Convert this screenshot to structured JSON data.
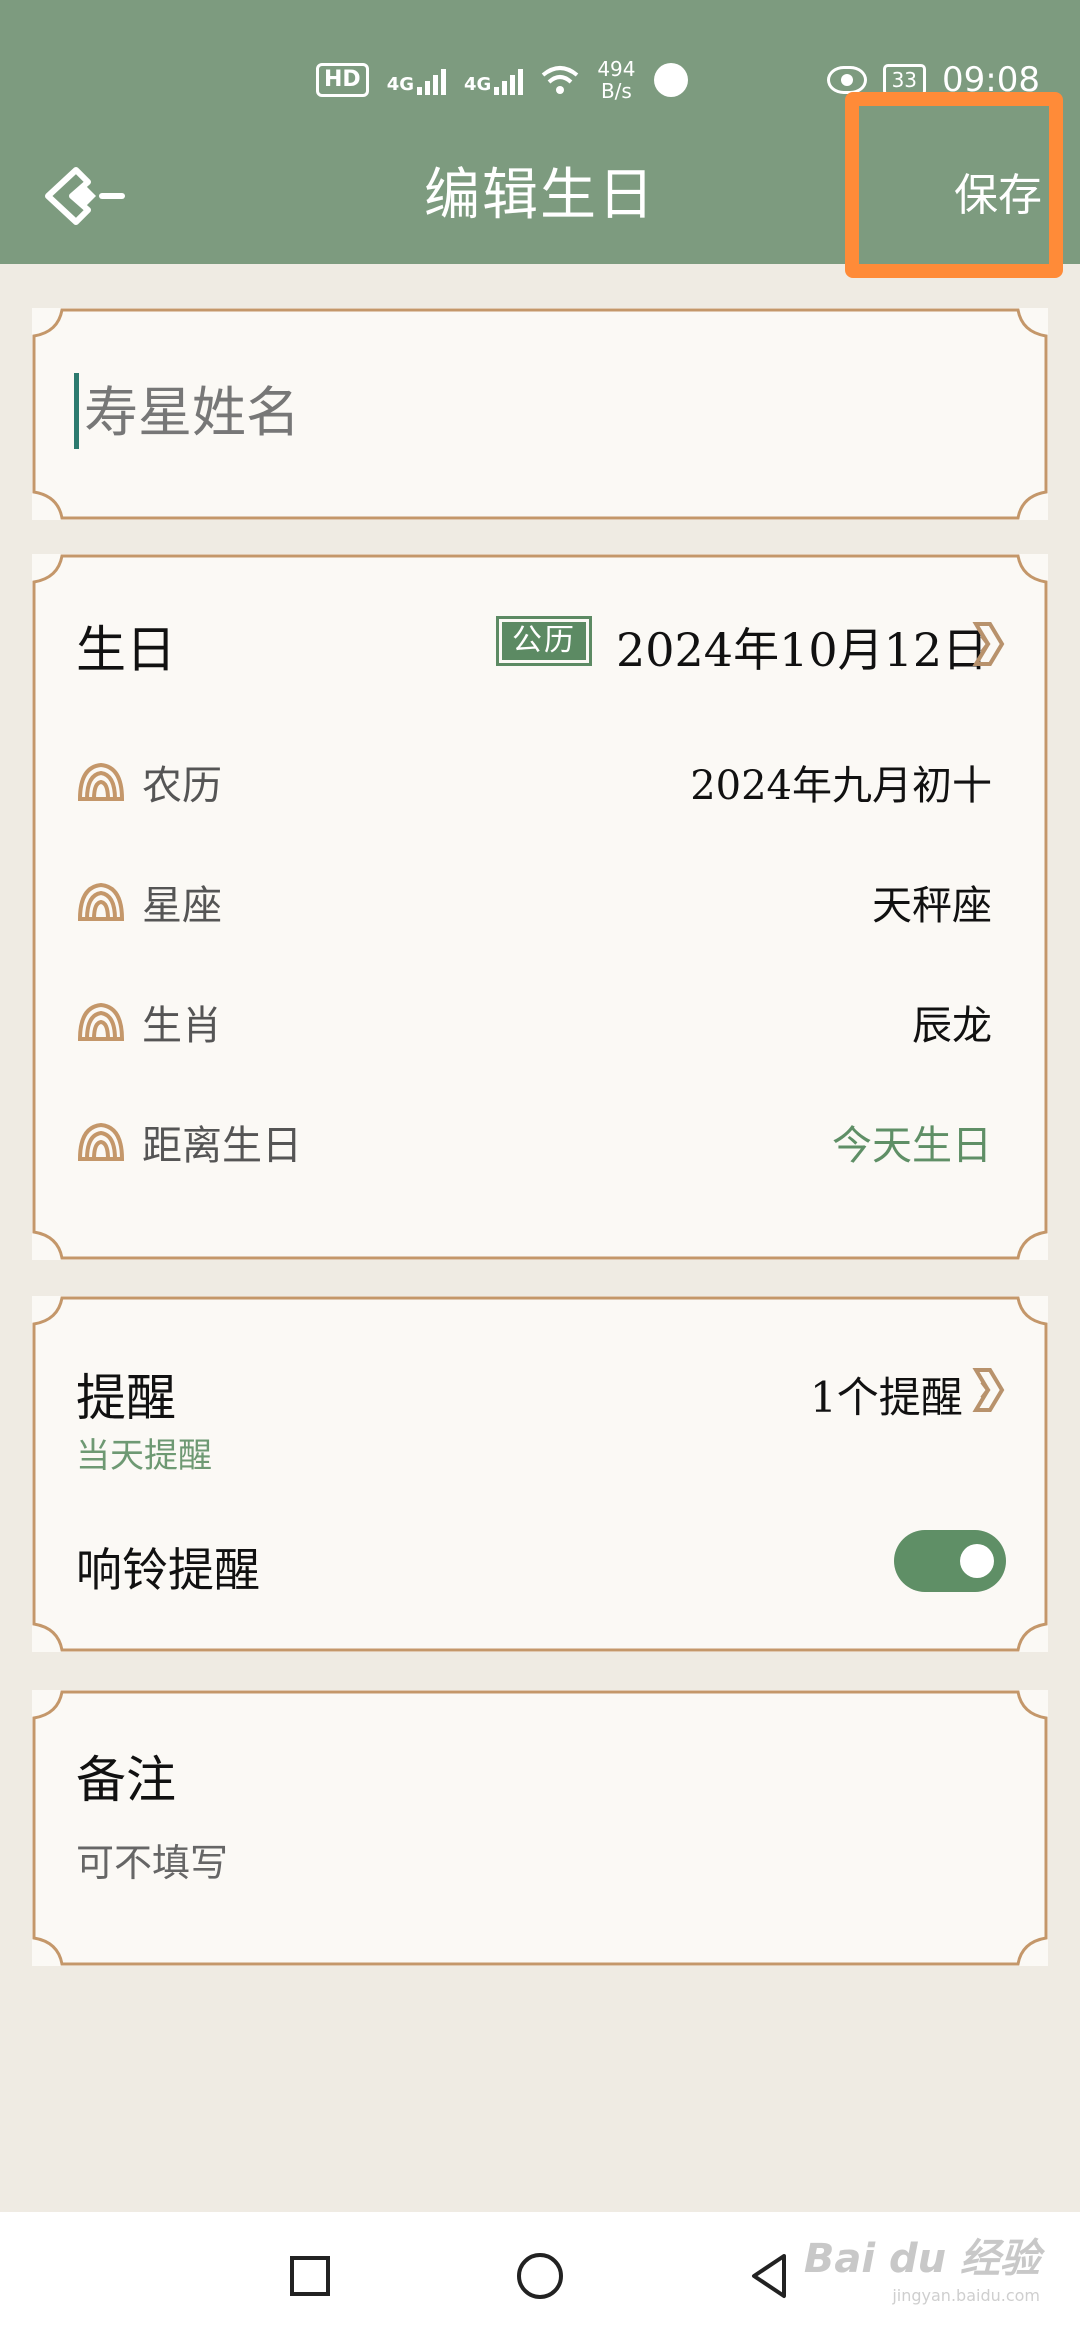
{
  "status_bar": {
    "hd": "HD",
    "sim1": "4G",
    "sim2": "4G",
    "speed_value": "494",
    "speed_unit": "B/s",
    "battery": "33",
    "time": "09:08"
  },
  "header": {
    "title": "编辑生日",
    "save_label": "保存"
  },
  "name_card": {
    "placeholder": "寿星姓名",
    "value": ""
  },
  "birthday_card": {
    "title": "生日",
    "calendar_type": "公历",
    "date": "2024年10月12日",
    "rows": [
      {
        "label": "农历",
        "value": "2024年九月初十"
      },
      {
        "label": "星座",
        "value": "天秤座"
      },
      {
        "label": "生肖",
        "value": "辰龙"
      },
      {
        "label": "距离生日",
        "value": "今天生日"
      }
    ]
  },
  "reminder_card": {
    "title": "提醒",
    "subtitle": "当天提醒",
    "count": "1个提醒",
    "ring_label": "响铃提醒",
    "ring_enabled": true
  },
  "remark_card": {
    "title": "备注",
    "placeholder": "可不填写"
  },
  "watermark": {
    "brand": "Bai du 经验",
    "url": "jingyan.baidu.com"
  },
  "colors": {
    "header_bg": "#7d9b7f",
    "accent_green": "#5f8f66",
    "card_border": "#c4976a",
    "page_bg": "#efebe3",
    "annotation": "#ff8b38"
  }
}
